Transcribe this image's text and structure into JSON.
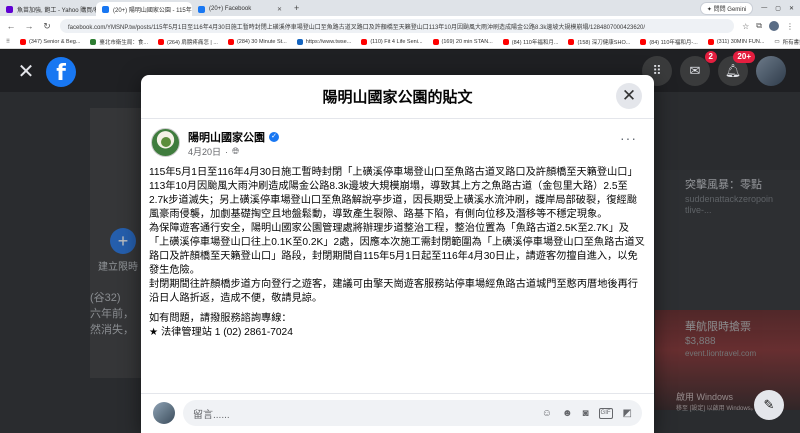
{
  "browser": {
    "tabs": [
      {
        "label": "魚苗加強, 飽工 - Yahoo 購買/秒",
        "color": "#6001d2",
        "active": false
      },
      {
        "label": "(20+) 陽明山國家公園 - 115年",
        "color": "#1877f2",
        "active": true
      },
      {
        "label": "(20+) Facebook",
        "color": "#1877f2",
        "active": false
      }
    ],
    "new_tab": "+",
    "gemini_label": "✦ 問問 Gemini",
    "url": "facebook.com/YMSNP.tw/posts/115年5月1日至116年4月30日施工暫時封閉上磺溪停車場登山口至魚路古道叉路口及許顏橋至天籟登山口113年10月因颱風大雨沖刷造成陽金公路8.3k邊坡大規模崩塌/1284807000423620/",
    "bookmarks": [
      {
        "label": "(347) Senior & Beg...",
        "color": "#ff0000"
      },
      {
        "label": "臺北市衛生局：食...",
        "color": "#2e7d32"
      },
      {
        "label": "(264) 肩膀疼痛怎 | ...",
        "color": "#ff0000"
      },
      {
        "label": "(284) 30 Minute St...",
        "color": "#ff0000"
      },
      {
        "label": "https://www.twse...",
        "color": "#1565c0"
      },
      {
        "label": "(110) Fit 4 Life Seni...",
        "color": "#ff0000"
      },
      {
        "label": "(169) 20 min STAN...",
        "color": "#ff0000"
      },
      {
        "label": "(84) 110年福和月...",
        "color": "#ff0000"
      },
      {
        "label": "(158) 深刀健康SHO...",
        "color": "#ff0000"
      },
      {
        "label": "(84) 110年福和月-...",
        "color": "#ff0000"
      },
      {
        "label": "(311) 30MIN FUN...",
        "color": "#ff0000"
      }
    ],
    "all_bookmarks": "所有書籤"
  },
  "fb": {
    "logo": "f",
    "messenger_badge": "2",
    "notif_badge": "20+",
    "bg_create_label": "建立限時",
    "bg_left_text": [
      "(谷32)",
      "六年前，",
      "然消失，"
    ],
    "bg_right_title": "突擊風暴：零點",
    "bg_right_sub": "suddenattackzeropoin tlive-...",
    "ad_title": "華航限時搶票",
    "ad_price": "$3,888",
    "ad_domain": "event.liontravel.com",
    "watermark_line1": "啟用 Windows",
    "watermark_line2": "移至 [設定] 以啟用 Windows。"
  },
  "modal": {
    "title": "陽明山國家公園的貼文",
    "page_name": "陽明山國家公園",
    "date": "4月20日",
    "privacy": "·",
    "paragraphs": [
      "115年5月1日至116年4月30日施工暫時封閉「上磺溪停車場登山口至魚路古道叉路口及許顏橋至天籟登山口」",
      "113年10月因颱風大雨沖刷造成陽金公路8.3k邊坡大規模崩塌，導致其上方之魚路古道（金包里大路）2.5至2.7k步道滅失；另上磺溪停車場登山口至魚路解說亭步道，因長期受上磺溪水流沖刷，護岸局部破裂，復經颱風豪雨侵襲，加劇基礎掏空且地盤鬆動，導致產生裂隙、路基下陷，有側向位移及潛移等不穩定現象。",
      "為保障遊客通行安全，陽明山國家公園管理處將辦理步道整治工程，整治位置為「魚路古道2.5K至2.7K」及「上磺溪停車場登山口往上0.1K至0.2K」2處，因應本次施工需封閉範圍為「上磺溪停車場登山口至魚路古道叉路口及許顏橋至天籟登山口」路段，封閉期間自115年5月1日起至116年4月30日止，請遊客勿擅自進入，以免發生危險。",
      "封閉期間往許顏橋步道方向登行之遊客，建議可由擎天崗遊客服務站停車場經魚路古道城門至憨丙厝地後再行沿日人路折返，造成不便，敬請見諒。",
      "如有問題，請撥服務諮詢專線：",
      "★ 法律管理站 1 (02) 2861-7024"
    ],
    "comment_placeholder": "留言......"
  }
}
